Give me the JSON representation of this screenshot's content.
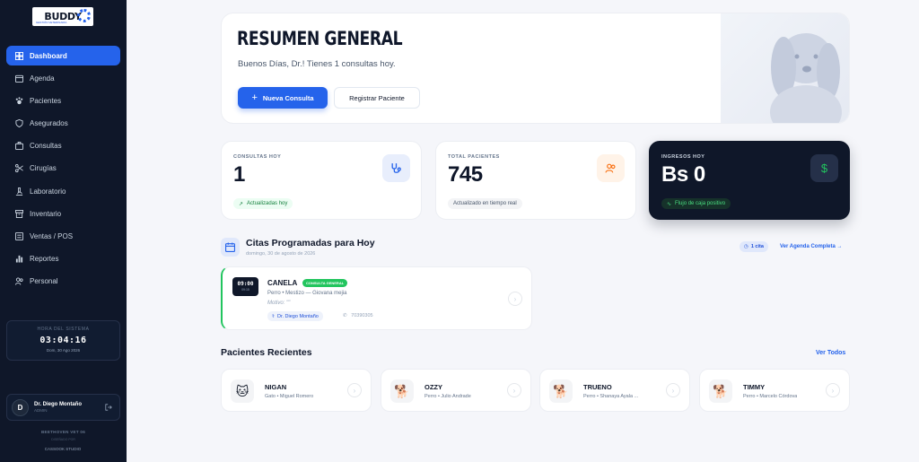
{
  "brand": {
    "logo_text": "BUDDY",
    "logo_sub": "GESTIÓN VETERINARIA"
  },
  "sidebar": {
    "items": [
      {
        "label": "Dashboard",
        "icon": "dashboard-icon",
        "active": true
      },
      {
        "label": "Agenda",
        "icon": "calendar-icon"
      },
      {
        "label": "Pacientes",
        "icon": "paw-icon"
      },
      {
        "label": "Asegurados",
        "icon": "shield-icon"
      },
      {
        "label": "Consultas",
        "icon": "briefcase-icon"
      },
      {
        "label": "Cirugías",
        "icon": "scissors-icon"
      },
      {
        "label": "Laboratorio",
        "icon": "microscope-icon"
      },
      {
        "label": "Inventario",
        "icon": "archive-icon"
      },
      {
        "label": "Ventas / POS",
        "icon": "register-icon"
      },
      {
        "label": "Reportes",
        "icon": "bar-chart-icon"
      },
      {
        "label": "Personal",
        "icon": "users-icon"
      }
    ],
    "clock": {
      "label": "HORA DEL SISTEMA",
      "time": "03:04:16",
      "date": "Dom, 30 Ago 2026"
    },
    "user": {
      "initial": "D",
      "name": "Dr. Diego Montaño",
      "role": "ADMIN"
    },
    "clinic": "BEETHOVEN VET 06",
    "powered": "DISEÑADO POR",
    "studio": "CASSOOK STUDIO"
  },
  "hero": {
    "title": "RESUMEN GENERAL",
    "subtitle": "Buenos Días, Dr.! Tienes 1 consultas hoy.",
    "primary_button": "Nueva Consulta",
    "secondary_button": "Registrar Paciente"
  },
  "stats": [
    {
      "label": "CONSULTAS HOY",
      "value": "1",
      "tag": "Actualizadas hoy",
      "icon": "stethoscope-icon"
    },
    {
      "label": "TOTAL PACIENTES",
      "value": "745",
      "tag": "Actualizado en tiempo real",
      "icon": "users-icon"
    },
    {
      "label": "INGRESOS HOY",
      "value": "Bs 0",
      "tag": "Flujo de caja positivo",
      "icon": "dollar-icon"
    }
  ],
  "appointments": {
    "title": "Citas Programadas para Hoy",
    "date": "domingo, 30 de agosto de 2026",
    "count": "1 cita",
    "view_all": "Ver Agenda Completa →",
    "items": [
      {
        "time": "09:00",
        "time_sub": "09:15",
        "pet": "CANELA",
        "type": "CONSULTA GENERAL",
        "meta": "Perro • Mestizo — Giovana mejia",
        "reason": "Motivo: \"\"",
        "doctor": "Dr. Diego Montaño",
        "phone": "70390305"
      }
    ]
  },
  "recent": {
    "title": "Pacientes Recientes",
    "view_all": "Ver Todos",
    "items": [
      {
        "name": "NIGAN",
        "meta": "Gato • Miguel Romero",
        "emoji": "🐱"
      },
      {
        "name": "OZZY",
        "meta": "Perro • Julio Andrade",
        "emoji": "🐕"
      },
      {
        "name": "TRUENO",
        "meta": "Perro • Shanaya Ayala ...",
        "emoji": "🐕"
      },
      {
        "name": "TIMMY",
        "meta": "Perro • Marcelo Córdova",
        "emoji": "🐕"
      }
    ]
  },
  "colors": {
    "primary": "#2563eb",
    "sidebar": "#0f1729",
    "success": "#22c55e",
    "orange": "#f97316"
  }
}
